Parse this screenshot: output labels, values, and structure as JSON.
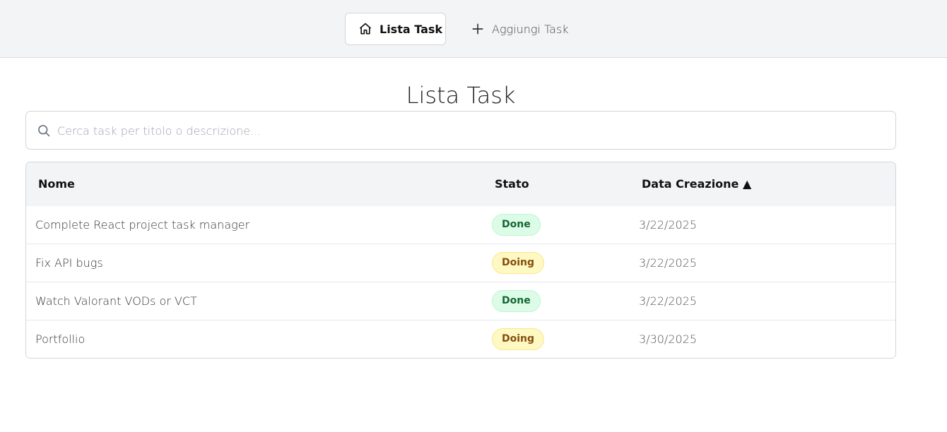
{
  "nav": {
    "list_label": "Lista Task",
    "add_label": "Aggiungi Task"
  },
  "page": {
    "title": "Lista Task"
  },
  "search": {
    "placeholder": "Cerca task per titolo o descrizione..."
  },
  "table": {
    "headers": {
      "name": "Nome",
      "status": "Stato",
      "created": "Data Creazione ▲"
    },
    "rows": [
      {
        "name": "Complete React project task manager",
        "status": "Done",
        "date": "3/22/2025"
      },
      {
        "name": "Fix API bugs",
        "status": "Doing",
        "date": "3/22/2025"
      },
      {
        "name": "Watch Valorant VODs or VCT",
        "status": "Done",
        "date": "3/22/2025"
      },
      {
        "name": "Portfollio",
        "status": "Doing",
        "date": "3/30/2025"
      }
    ]
  },
  "colors": {
    "done_bg": "#dcfce7",
    "doing_bg": "#fef9c3",
    "nav_bg": "#f3f4f6"
  },
  "icons": {
    "list": "home-icon",
    "add": "plus-icon",
    "search": "search-icon"
  }
}
